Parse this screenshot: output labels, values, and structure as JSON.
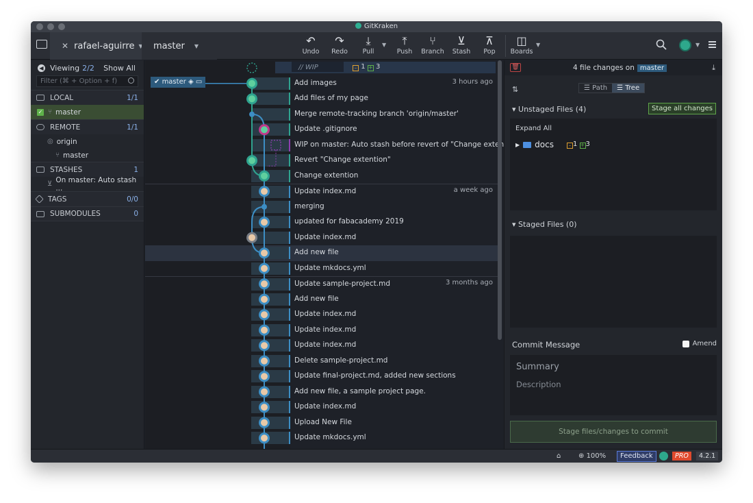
{
  "window": {
    "title": "GitKraken"
  },
  "toolbar": {
    "repo": "rafael-aguirre",
    "branch": "master",
    "buttons": [
      {
        "label": "Undo",
        "icon": "undo-icon"
      },
      {
        "label": "Redo",
        "icon": "redo-icon"
      },
      {
        "label": "Pull",
        "icon": "pull-icon"
      },
      {
        "label": "Push",
        "icon": "push-icon"
      },
      {
        "label": "Branch",
        "icon": "branch-icon"
      },
      {
        "label": "Stash",
        "icon": "stash-icon"
      },
      {
        "label": "Pop",
        "icon": "pop-icon"
      },
      {
        "label": "Boards",
        "icon": "boards-icon"
      }
    ]
  },
  "sidebar": {
    "viewing_label": "Viewing",
    "viewing_count": "2/2",
    "show_all": "Show All",
    "filter_placeholder": "Filter (⌘ + Option + f)",
    "local": {
      "label": "LOCAL",
      "count": "1/1",
      "items": [
        "master"
      ]
    },
    "remote": {
      "label": "REMOTE",
      "count": "1/1",
      "origin": "origin",
      "items": [
        "master"
      ]
    },
    "stashes": {
      "label": "STASHES",
      "count": "1",
      "items": [
        "On master: Auto stash ..."
      ]
    },
    "tags": {
      "label": "TAGS",
      "count": "0/0"
    },
    "submodules": {
      "label": "SUBMODULES",
      "count": "0"
    }
  },
  "graph": {
    "wip_label": "// WIP",
    "wip_modified": "1",
    "wip_added": "3",
    "branch_tag": "master",
    "commits": [
      {
        "message": "Add images",
        "time": "3 hours ago"
      },
      {
        "message": "Add files of my page",
        "time": ""
      },
      {
        "message": "Merge remote-tracking branch 'origin/master'",
        "time": ""
      },
      {
        "message": "Update .gitignore",
        "time": ""
      },
      {
        "message": "WIP on master: Auto stash before revert of \"Change extention\"",
        "time": ""
      },
      {
        "message": "Revert \"Change extention\"",
        "time": ""
      },
      {
        "message": "Change extention",
        "time": ""
      },
      {
        "message": "Update index.md",
        "time": "a week ago"
      },
      {
        "message": "merging",
        "time": ""
      },
      {
        "message": "updated for fabacademy 2019",
        "time": ""
      },
      {
        "message": "Update index.md",
        "time": ""
      },
      {
        "message": "Add new file",
        "time": ""
      },
      {
        "message": "Update mkdocs.yml",
        "time": ""
      },
      {
        "message": "Update sample-project.md",
        "time": "3 months ago"
      },
      {
        "message": "Add new file",
        "time": ""
      },
      {
        "message": "Update index.md",
        "time": ""
      },
      {
        "message": "Update index.md",
        "time": ""
      },
      {
        "message": "Update index.md",
        "time": ""
      },
      {
        "message": "Delete sample-project.md",
        "time": ""
      },
      {
        "message": "Update final-project.md, added new sections",
        "time": ""
      },
      {
        "message": "Add new file, a sample project page.",
        "time": ""
      },
      {
        "message": "Update index.md",
        "time": ""
      },
      {
        "message": "Upload New File",
        "time": ""
      },
      {
        "message": "Update mkdocs.yml",
        "time": ""
      }
    ]
  },
  "panel": {
    "file_changes": "4 file changes on",
    "branch": "master",
    "path_tab": "Path",
    "tree_tab": "Tree",
    "unstaged_header": "Unstaged Files (4)",
    "stage_all": "Stage all changes",
    "expand_all": "Expand All",
    "folder": "docs",
    "folder_modified": "1",
    "folder_added": "3",
    "staged_header": "Staged Files (0)",
    "commit_message_label": "Commit Message",
    "amend": "Amend",
    "summary_placeholder": "Summary",
    "description_placeholder": "Description",
    "commit_button": "Stage files/changes to commit"
  },
  "statusbar": {
    "zoom": "100%",
    "feedback": "Feedback",
    "pro": "PRO",
    "version": "4.2.1"
  },
  "colors": {
    "accent_blue": "#3d8ec4",
    "branch_tag": "#2d5a7c",
    "stage_green": "#5fa54a",
    "pro_badge": "#e04a2d"
  }
}
